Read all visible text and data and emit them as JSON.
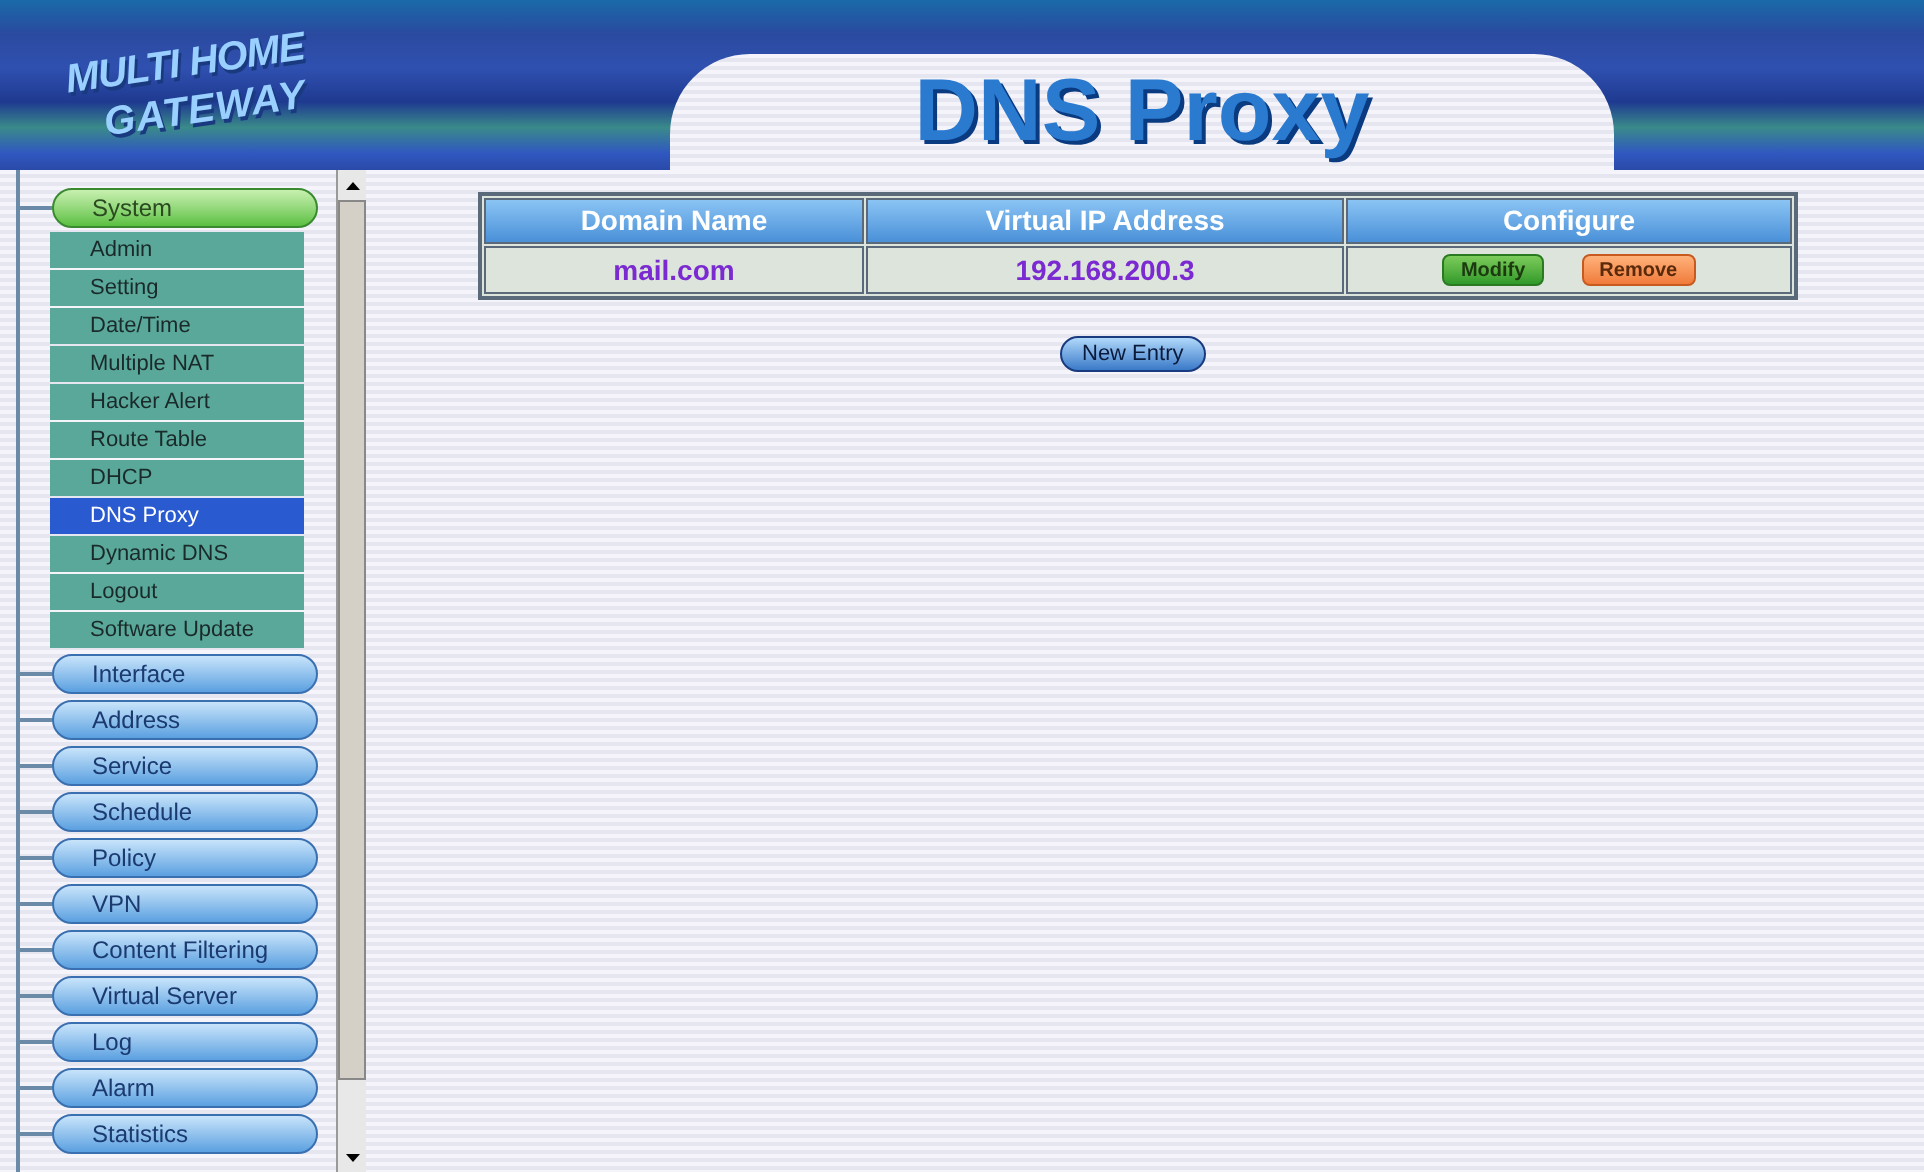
{
  "logo": {
    "line_1": "MULTI HOME",
    "line_2": "GATEWAY"
  },
  "page_title": "DNS Proxy",
  "sidebar": {
    "items": [
      {
        "label": "System",
        "selected": true,
        "children": [
          {
            "label": "Admin",
            "selected": false
          },
          {
            "label": "Setting",
            "selected": false
          },
          {
            "label": "Date/Time",
            "selected": false
          },
          {
            "label": "Multiple NAT",
            "selected": false
          },
          {
            "label": "Hacker Alert",
            "selected": false
          },
          {
            "label": "Route Table",
            "selected": false
          },
          {
            "label": "DHCP",
            "selected": false
          },
          {
            "label": "DNS Proxy",
            "selected": true
          },
          {
            "label": "Dynamic DNS",
            "selected": false
          },
          {
            "label": "Logout",
            "selected": false
          },
          {
            "label": "Software Update",
            "selected": false
          }
        ]
      },
      {
        "label": "Interface",
        "selected": false
      },
      {
        "label": "Address",
        "selected": false
      },
      {
        "label": "Service",
        "selected": false
      },
      {
        "label": "Schedule",
        "selected": false
      },
      {
        "label": "Policy",
        "selected": false
      },
      {
        "label": "VPN",
        "selected": false
      },
      {
        "label": "Content Filtering",
        "selected": false
      },
      {
        "label": "Virtual Server",
        "selected": false
      },
      {
        "label": "Log",
        "selected": false
      },
      {
        "label": "Alarm",
        "selected": false
      },
      {
        "label": "Statistics",
        "selected": false
      }
    ]
  },
  "table": {
    "columns": [
      "Domain Name",
      "Virtual IP Address",
      "Configure"
    ],
    "rows": [
      {
        "domain": "mail.com",
        "ip": "192.168.200.3",
        "actions": [
          {
            "kind": "modify",
            "label": "Modify"
          },
          {
            "kind": "remove",
            "label": "Remove"
          }
        ]
      }
    ]
  },
  "new_entry_button": "New Entry"
}
